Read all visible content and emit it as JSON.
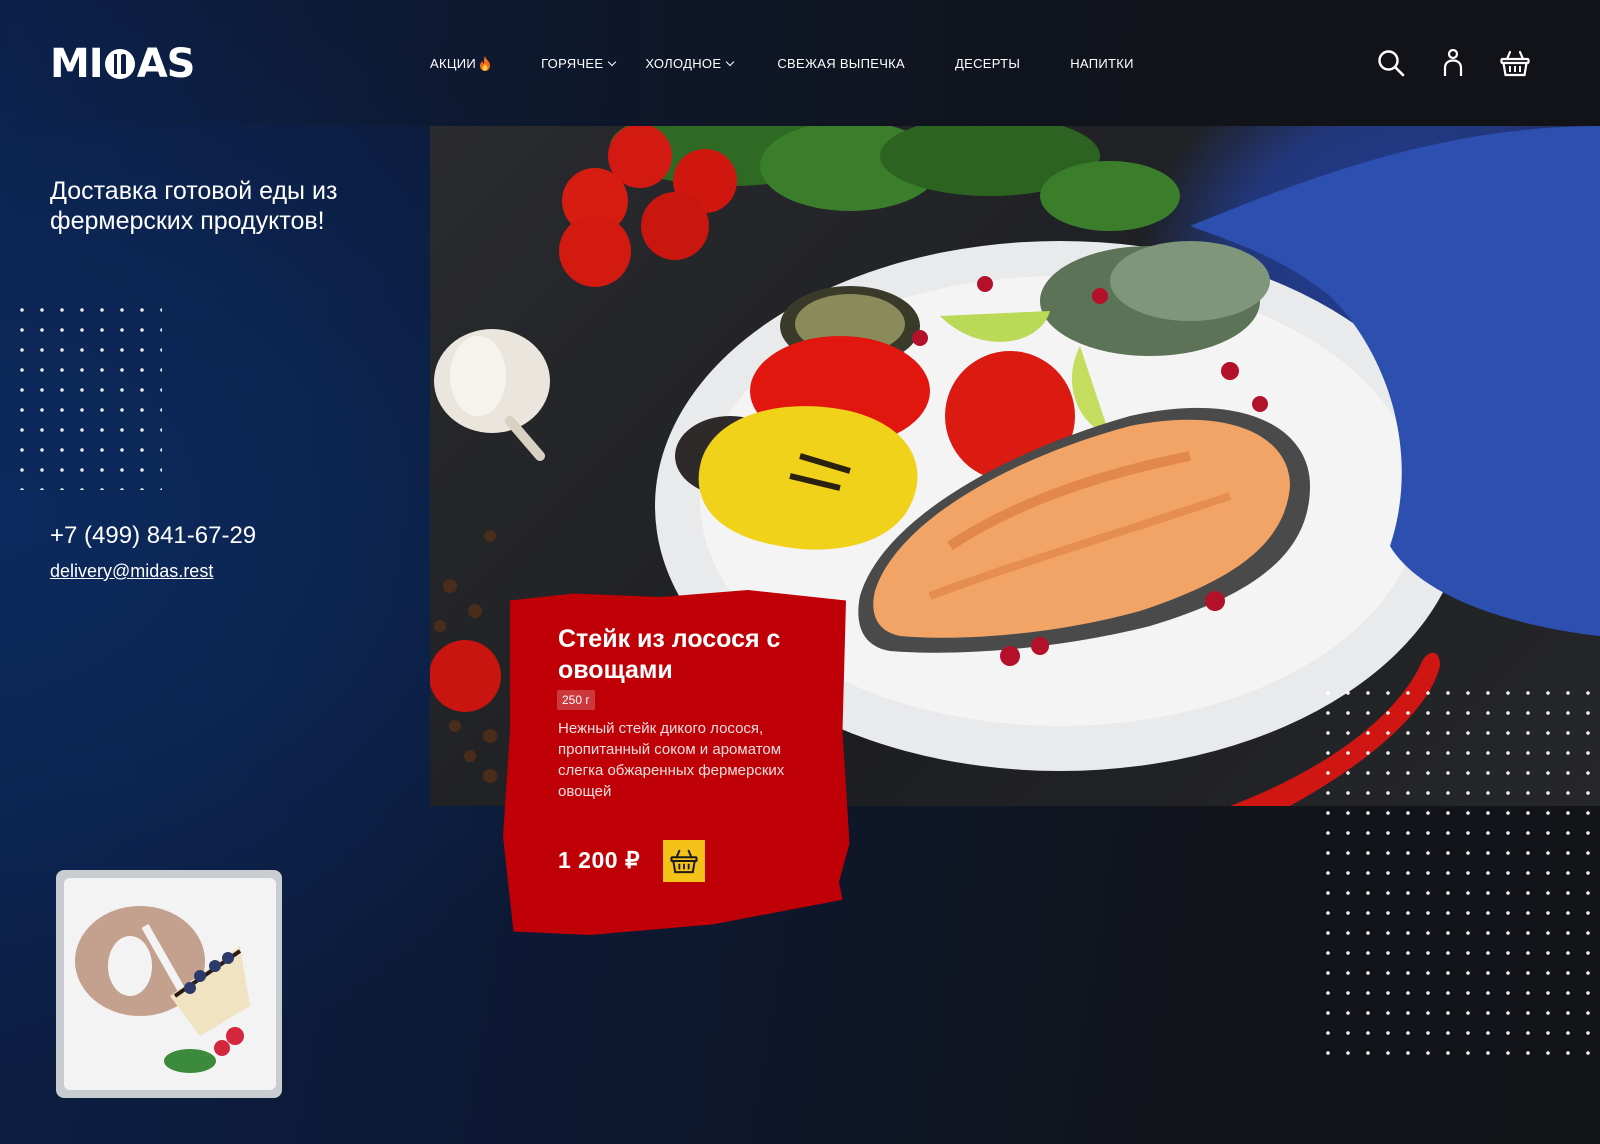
{
  "brand": {
    "logo_left": "MI",
    "logo_right": "AS",
    "logo_full": "MIDAS"
  },
  "nav": {
    "items": [
      {
        "label": "АКЦИИ",
        "icon": "fire-icon",
        "dropdown": false
      },
      {
        "label": "ГОРЯЧЕЕ",
        "dropdown": true
      },
      {
        "label": "ХОЛОДНОЕ",
        "dropdown": true
      },
      {
        "label": "СВЕЖАЯ ВЫПЕЧКА",
        "dropdown": false
      },
      {
        "label": "ДЕСЕРТЫ",
        "dropdown": false
      },
      {
        "label": "НАПИТКИ",
        "dropdown": false
      }
    ],
    "icons": [
      "search-icon",
      "user-icon",
      "basket-icon"
    ]
  },
  "hero": {
    "tagline": "Доставка готовой еды из фермерских продуктов!",
    "phone": "+7 (499) 841-67-29",
    "email": "delivery@midas.rest"
  },
  "product": {
    "title": "Стейк из лосося с овощами",
    "weight": "250 г",
    "description": "Нежный стейк дикого лосося, пропитанный соком и ароматом слегка обжаренных фермерских овощей",
    "price": "1 200 ₽",
    "cart_icon": "basket-icon"
  },
  "colors": {
    "accent_red": "#bf0006",
    "accent_yellow": "#f5c21a",
    "background_navy": "#0b1f48",
    "background_dark": "#131418"
  }
}
